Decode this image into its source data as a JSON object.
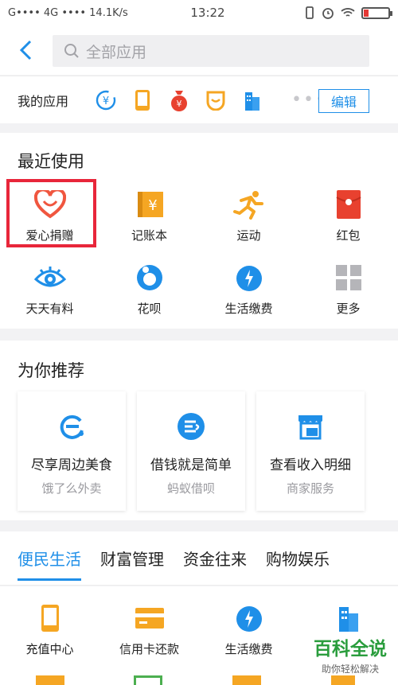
{
  "status_bar": {
    "left": "G•••• 4G •••• 14.1K/s",
    "time": "13:22",
    "battery_level": 0.2
  },
  "header": {
    "search_placeholder": "全部应用"
  },
  "my_apps": {
    "label": "我的应用",
    "icons": [
      "yuebao-icon",
      "phone-recharge-icon",
      "money-bag-icon",
      "smile-cup-icon",
      "building-icon"
    ],
    "edit_label": "编辑"
  },
  "recent": {
    "title": "最近使用",
    "items": [
      {
        "label": "爱心捐赠",
        "icon": "heart-icon",
        "color": "#f0563f"
      },
      {
        "label": "记账本",
        "icon": "ledger-icon",
        "color": "#f5a623"
      },
      {
        "label": "运动",
        "icon": "running-icon",
        "color": "#f5a623"
      },
      {
        "label": "红包",
        "icon": "red-envelope-icon",
        "color": "#e8412f"
      },
      {
        "label": "天天有料",
        "icon": "eye-icon",
        "color": "#1f8fe8"
      },
      {
        "label": "花呗",
        "icon": "huabei-icon",
        "color": "#1f8fe8"
      },
      {
        "label": "生活缴费",
        "icon": "water-drop-icon",
        "color": "#1f8fe8"
      },
      {
        "label": "更多",
        "icon": "grid-more-icon",
        "color": "#b5b5b9"
      }
    ]
  },
  "recommend": {
    "title": "为你推荐",
    "cards": [
      {
        "title": "尽享周边美食",
        "sub": "饿了么外卖",
        "icon": "eleme-icon"
      },
      {
        "title": "借钱就是简单",
        "sub": "蚂蚁借呗",
        "icon": "jiebei-icon"
      },
      {
        "title": "查看收入明细",
        "sub": "商家服务",
        "icon": "shop-icon"
      }
    ]
  },
  "tabs": [
    "便民生活",
    "财富管理",
    "资金往来",
    "购物娱乐"
  ],
  "bottom_items": [
    {
      "label": "充值中心",
      "icon": "phone-recharge-icon"
    },
    {
      "label": "信用卡还款",
      "icon": "credit-card-icon"
    },
    {
      "label": "生活缴费",
      "icon": "water-drop-icon"
    },
    {
      "label": "",
      "icon": "building-icon"
    }
  ],
  "watermark": {
    "title": "百科全说",
    "sub": "助你轻松解决"
  },
  "colors": {
    "accent": "#1f8fe8",
    "highlight": "#e8263a",
    "orange": "#f5a623"
  }
}
